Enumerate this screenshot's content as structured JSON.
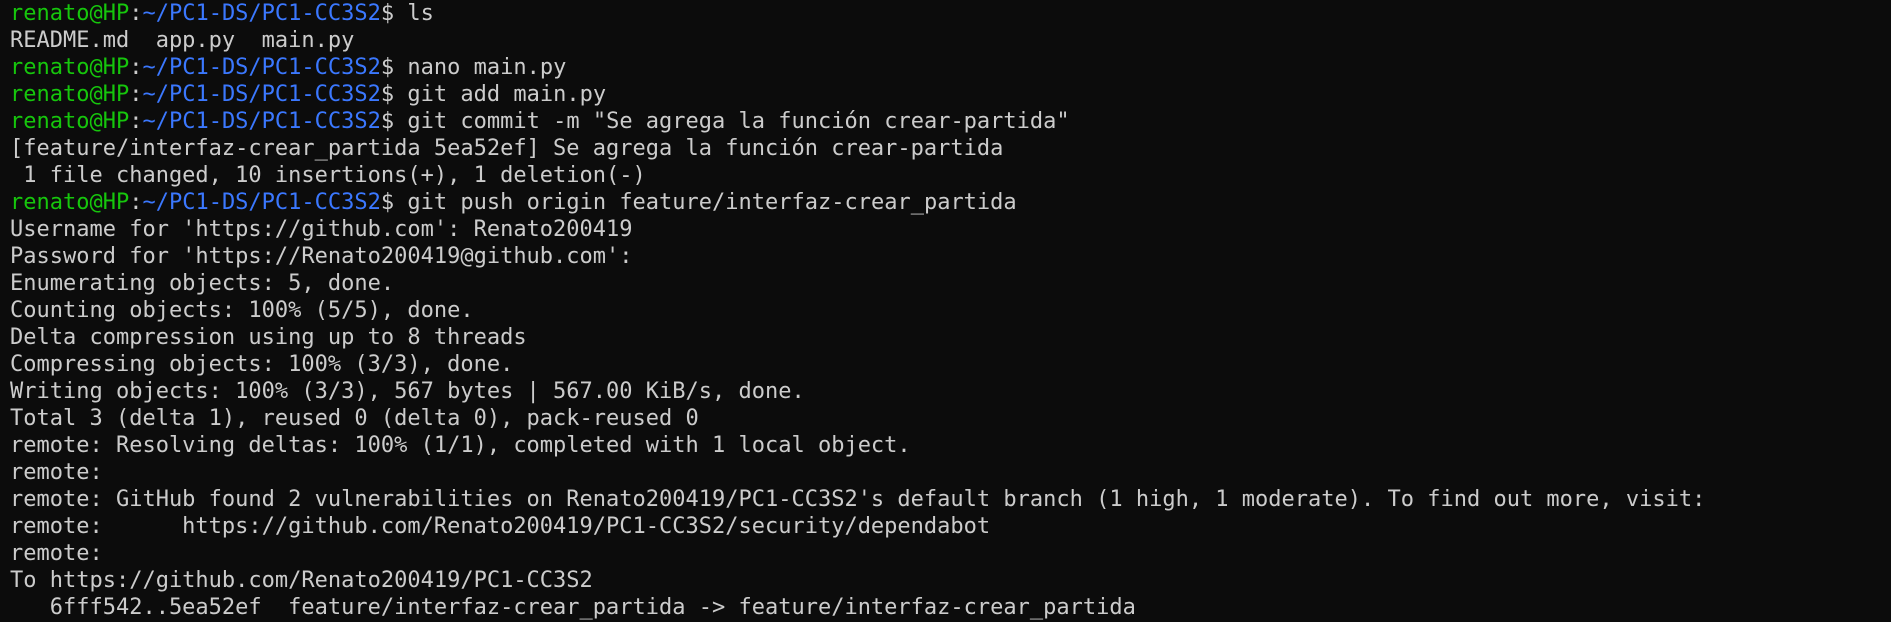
{
  "prompt": {
    "user_host": "renato@HP",
    "separator": ":",
    "path": "~/PC1-DS/PC1-CC3S2",
    "symbol": "$ "
  },
  "colors": {
    "background": "#0c0c0c",
    "text": "#cccccc",
    "user": "#16c60c",
    "path": "#3b78ff"
  },
  "lines": [
    {
      "type": "prompt",
      "command": "ls"
    },
    {
      "type": "output",
      "text": "README.md  app.py  main.py"
    },
    {
      "type": "prompt",
      "command": "nano main.py"
    },
    {
      "type": "prompt",
      "command": "git add main.py"
    },
    {
      "type": "prompt",
      "command": "git commit -m \"Se agrega la función crear-partida\""
    },
    {
      "type": "output",
      "text": "[feature/interfaz-crear_partida 5ea52ef] Se agrega la función crear-partida"
    },
    {
      "type": "output",
      "text": " 1 file changed, 10 insertions(+), 1 deletion(-)"
    },
    {
      "type": "prompt",
      "command": "git push origin feature/interfaz-crear_partida"
    },
    {
      "type": "output",
      "text": "Username for 'https://github.com': Renato200419"
    },
    {
      "type": "output",
      "text": "Password for 'https://Renato200419@github.com':"
    },
    {
      "type": "output",
      "text": "Enumerating objects: 5, done."
    },
    {
      "type": "output",
      "text": "Counting objects: 100% (5/5), done."
    },
    {
      "type": "output",
      "text": "Delta compression using up to 8 threads"
    },
    {
      "type": "output",
      "text": "Compressing objects: 100% (3/3), done."
    },
    {
      "type": "output",
      "text": "Writing objects: 100% (3/3), 567 bytes | 567.00 KiB/s, done."
    },
    {
      "type": "output",
      "text": "Total 3 (delta 1), reused 0 (delta 0), pack-reused 0"
    },
    {
      "type": "output",
      "text": "remote: Resolving deltas: 100% (1/1), completed with 1 local object."
    },
    {
      "type": "output",
      "text": "remote:"
    },
    {
      "type": "output",
      "text": "remote: GitHub found 2 vulnerabilities on Renato200419/PC1-CC3S2's default branch (1 high, 1 moderate). To find out more, visit:"
    },
    {
      "type": "output",
      "text": "remote:      https://github.com/Renato200419/PC1-CC3S2/security/dependabot"
    },
    {
      "type": "output",
      "text": "remote:"
    },
    {
      "type": "output",
      "text": "To https://github.com/Renato200419/PC1-CC3S2"
    },
    {
      "type": "output",
      "text": "   6fff542..5ea52ef  feature/interfaz-crear_partida -> feature/interfaz-crear_partida"
    }
  ]
}
